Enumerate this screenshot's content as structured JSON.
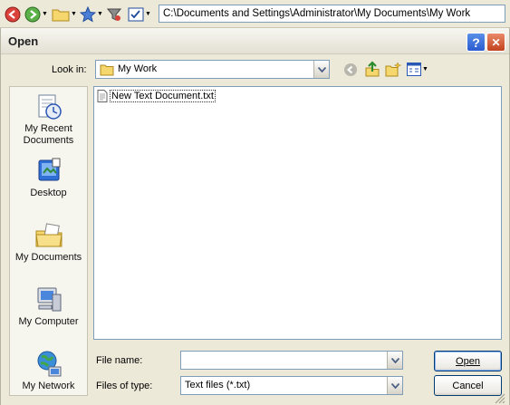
{
  "toolbar": {
    "address": "C:\\Documents and Settings\\Administrator\\My Documents\\My Work"
  },
  "dialog": {
    "title": "Open",
    "help_label": "?",
    "close_label": "✕",
    "look_in_label": "Look in:",
    "look_in_value": "My Work",
    "places": [
      {
        "label": "My Recent Documents",
        "icon": "recent-documents-icon"
      },
      {
        "label": "Desktop",
        "icon": "desktop-icon"
      },
      {
        "label": "My Documents",
        "icon": "my-documents-icon"
      },
      {
        "label": "My Computer",
        "icon": "my-computer-icon"
      },
      {
        "label": "My Network",
        "icon": "my-network-icon"
      }
    ],
    "files": [
      {
        "name": "New Text Document.txt",
        "icon": "text-file-icon"
      }
    ],
    "file_name_label": "File name:",
    "file_name_value": "",
    "files_of_type_label": "Files of type:",
    "files_of_type_value": "Text files (*.txt)",
    "open_label": "Open",
    "cancel_label": "Cancel"
  },
  "colors": {
    "face": "#ECE9D8",
    "field_border": "#7f9db9",
    "button_border": "#003c74"
  }
}
